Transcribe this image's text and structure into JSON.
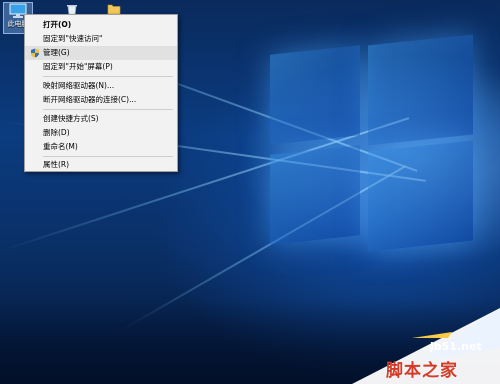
{
  "desktop": {
    "icons": [
      {
        "label": "此电脑",
        "icon": "this-pc-icon"
      },
      {
        "label": "",
        "icon": "recycle-bin-icon"
      },
      {
        "label": "",
        "icon": "folder-icon"
      }
    ]
  },
  "context_menu": {
    "items": [
      {
        "label": "打开(O)",
        "bold": true
      },
      {
        "label": "固定到\"快速访问\""
      },
      {
        "label": "管理(G)",
        "icon": "shield-icon",
        "hovered": true
      },
      {
        "label": "固定到\"开始\"屏幕(P)"
      },
      {
        "label": "映射网络驱动器(N)..."
      },
      {
        "label": "断开网络驱动器的连接(C)..."
      },
      {
        "label": "创建快捷方式(S)"
      },
      {
        "label": "删除(D)"
      },
      {
        "label": "重命名(M)"
      },
      {
        "label": "属性(R)"
      }
    ]
  },
  "watermark": {
    "site": "jb51.net",
    "name": "脚本之家"
  },
  "colors": {
    "menu_background": "#f2f2f2",
    "menu_hover": "#e1e1e1",
    "watermark_red": "#d23c28",
    "desktop_blue": "#0b3c80"
  }
}
